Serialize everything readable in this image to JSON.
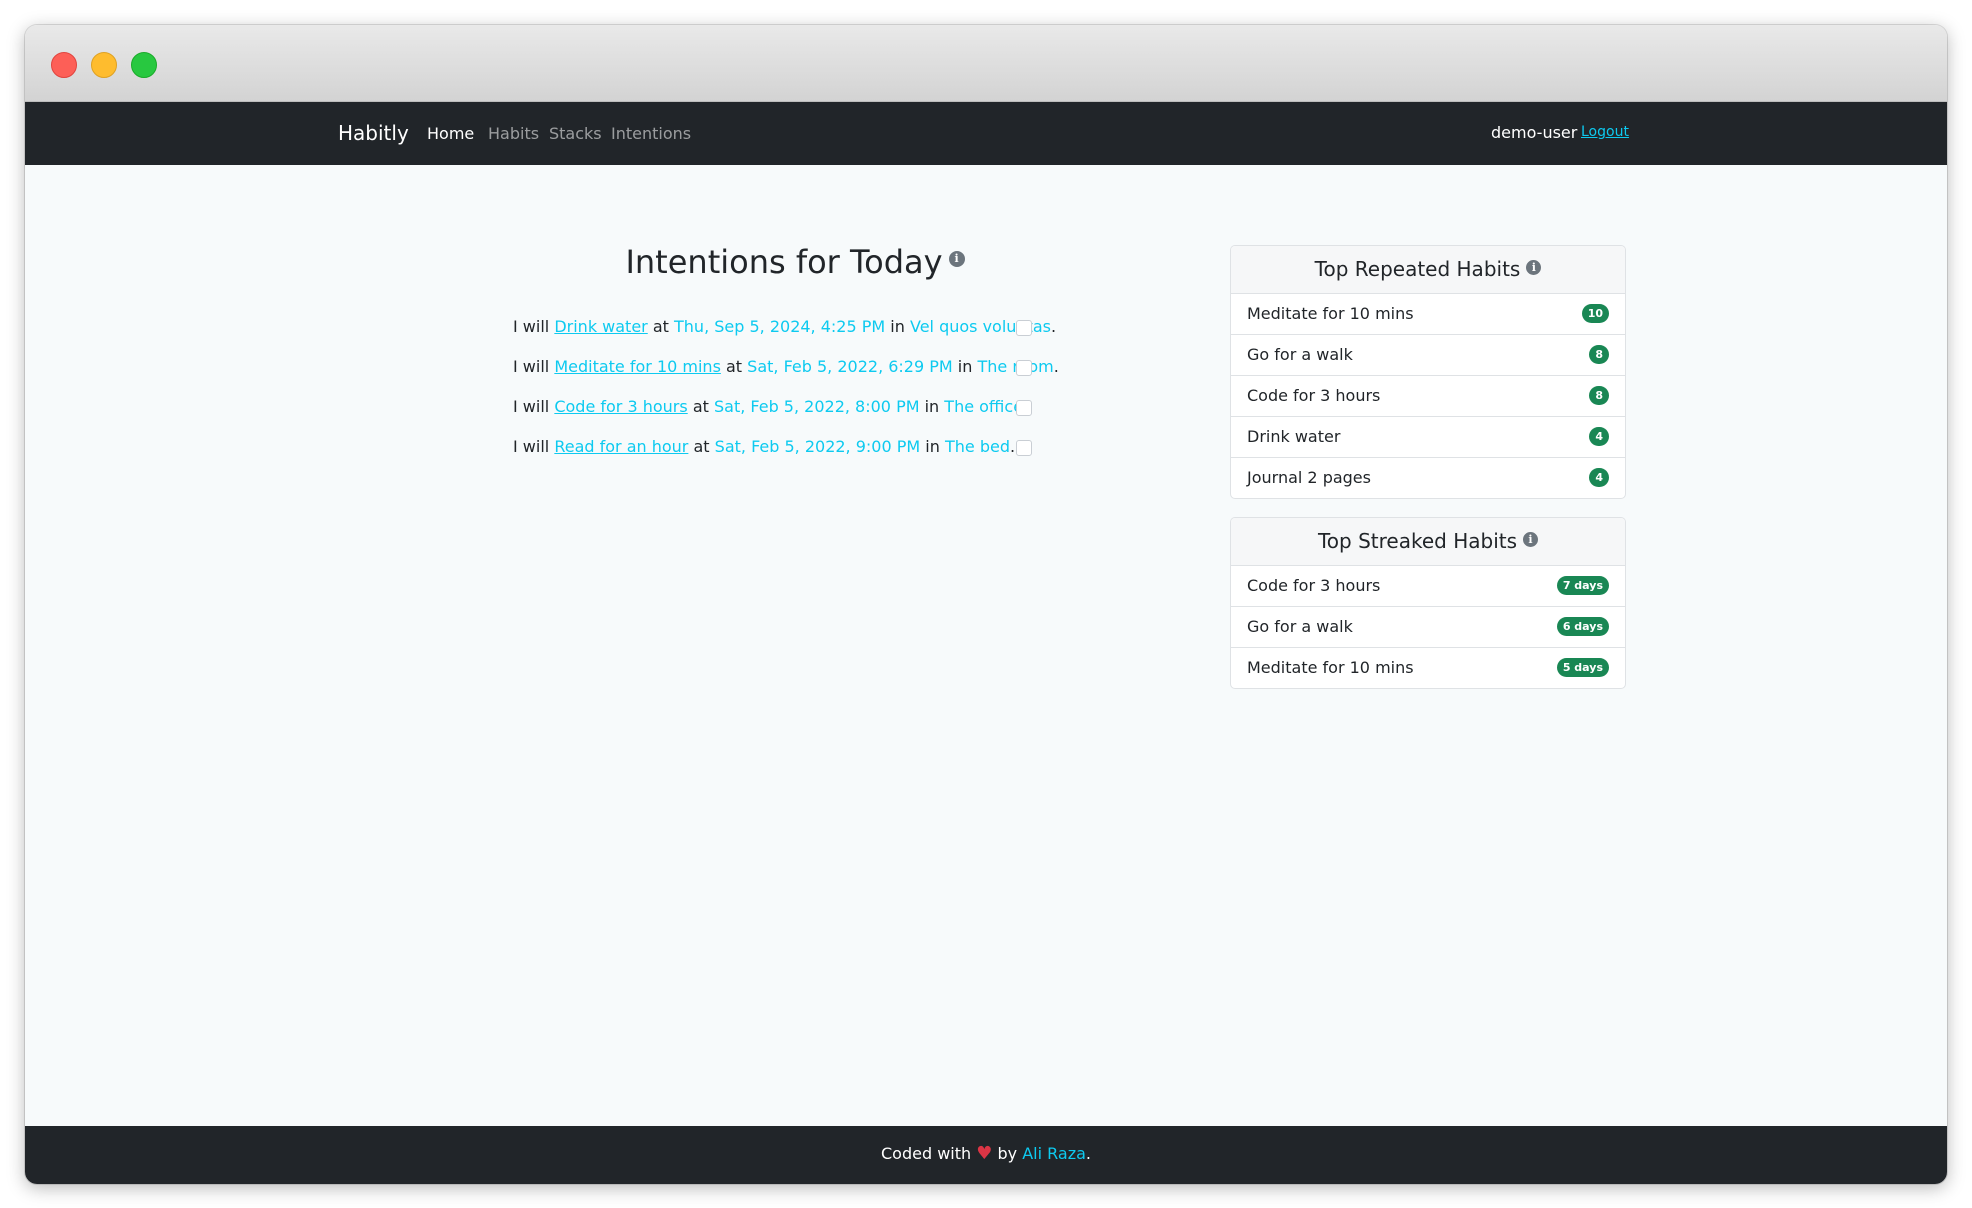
{
  "navbar": {
    "brand": "Habitly",
    "links": [
      "Home",
      "Habits",
      "Stacks",
      "Intentions"
    ],
    "active": "Home",
    "user": "demo-user",
    "logout": "Logout"
  },
  "main": {
    "title": "Intentions for Today",
    "info_icon": "i",
    "prefix": "I will",
    "at": "at",
    "in": "in",
    "period": ".",
    "intentions": [
      {
        "habit": "Drink water",
        "time": "Thu, Sep 5, 2024, 4:25 PM",
        "location": "Vel quos voluptas"
      },
      {
        "habit": "Meditate for 10 mins",
        "time": "Sat, Feb 5, 2022, 6:29 PM",
        "location": "The room"
      },
      {
        "habit": "Code for 3 hours",
        "time": "Sat, Feb 5, 2022, 8:00 PM",
        "location": "The office"
      },
      {
        "habit": "Read for an hour",
        "time": "Sat, Feb 5, 2022, 9:00 PM",
        "location": "The bed"
      }
    ]
  },
  "top_repeated": {
    "title": "Top Repeated Habits",
    "items": [
      {
        "name": "Meditate for 10 mins",
        "count": "10"
      },
      {
        "name": "Go for a walk",
        "count": "8"
      },
      {
        "name": "Code for 3 hours",
        "count": "8"
      },
      {
        "name": "Drink water",
        "count": "4"
      },
      {
        "name": "Journal 2 pages",
        "count": "4"
      }
    ]
  },
  "top_streaked": {
    "title": "Top Streaked Habits",
    "items": [
      {
        "name": "Code for 3 hours",
        "streak": "7 days"
      },
      {
        "name": "Go for a walk",
        "streak": "6 days"
      },
      {
        "name": "Meditate for 10 mins",
        "streak": "5 days"
      }
    ]
  },
  "footer": {
    "text_before": "Coded with",
    "heart": "♥",
    "by": "by",
    "author": "Ali Raza",
    "period": "."
  },
  "colors": {
    "navbar_bg": "#212529",
    "link": "#0dcaf0",
    "badge": "#198754",
    "page_bg": "#f7fafb"
  }
}
